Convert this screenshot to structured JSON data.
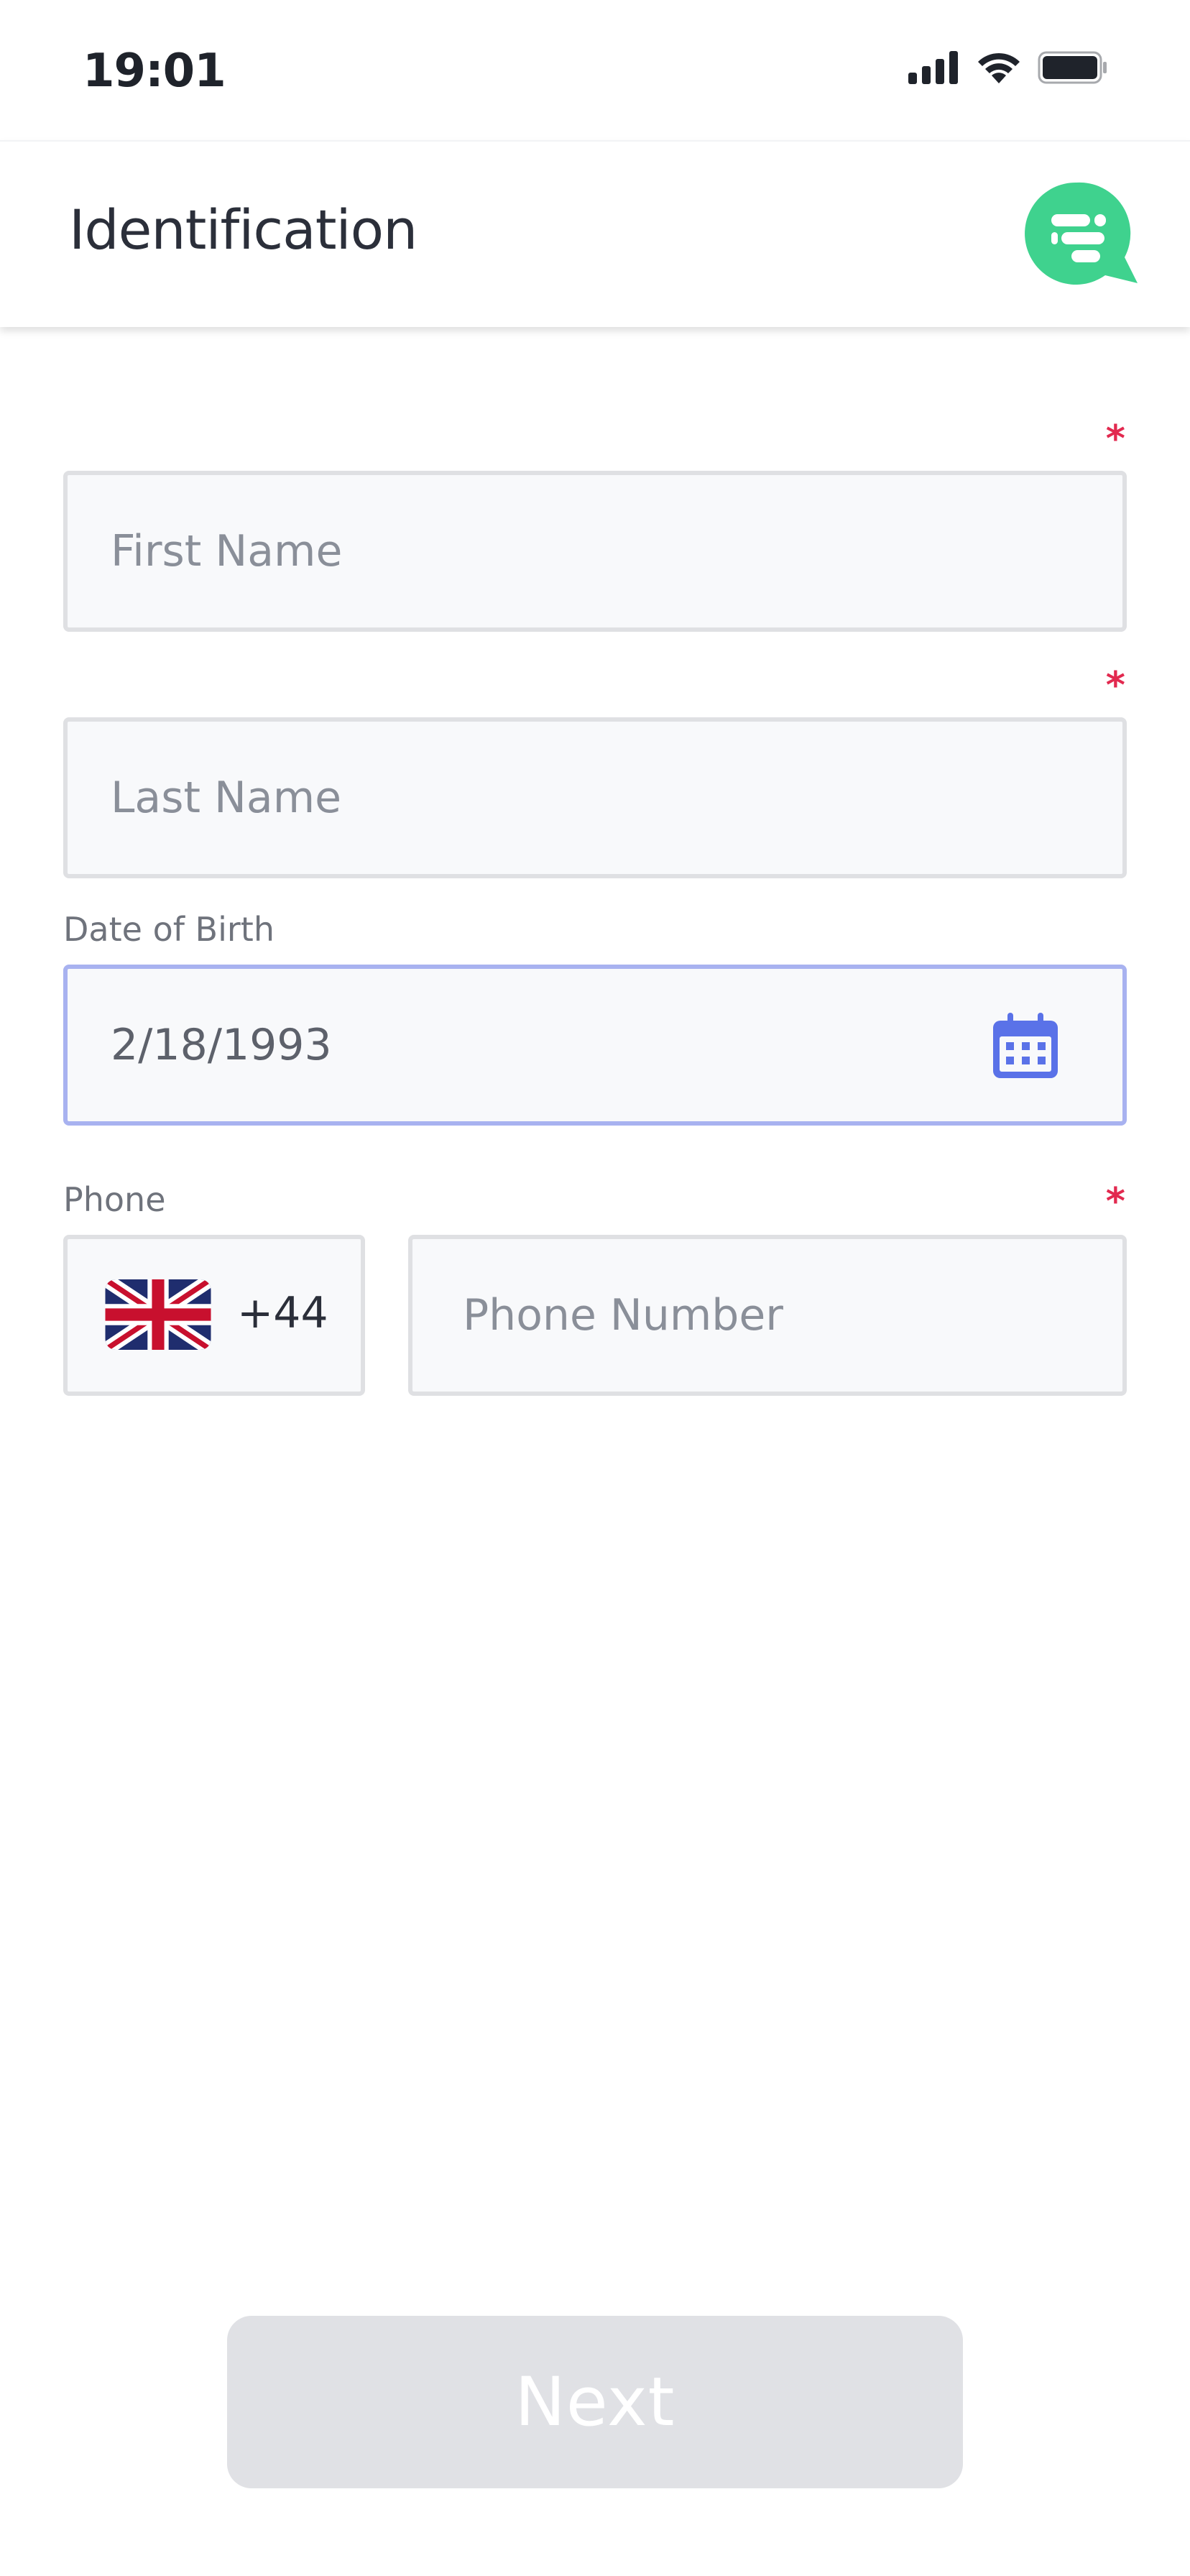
{
  "status_bar": {
    "time": "19:01"
  },
  "header": {
    "title": "Identification"
  },
  "form": {
    "first_name": {
      "placeholder": "First Name",
      "value": "",
      "required_mark": "*"
    },
    "last_name": {
      "placeholder": "Last Name",
      "value": "",
      "required_mark": "*"
    },
    "date_of_birth": {
      "label": "Date of Birth",
      "value": "2/18/1993"
    },
    "phone": {
      "label": "Phone",
      "required_mark": "*",
      "country_flag": "uk-flag",
      "dial_code": "+44",
      "placeholder": "Phone Number",
      "value": ""
    }
  },
  "footer": {
    "next_label": "Next"
  },
  "colors": {
    "accent_blue": "#5a72e8",
    "chat_green": "#3fd28e",
    "required_red": "#e2294f",
    "disabled_button": "#e0e1e5"
  },
  "icons": {
    "signal": "signal-icon",
    "wifi": "wifi-icon",
    "battery": "battery-icon",
    "chat": "chat-bubble-icon",
    "calendar": "calendar-icon"
  }
}
